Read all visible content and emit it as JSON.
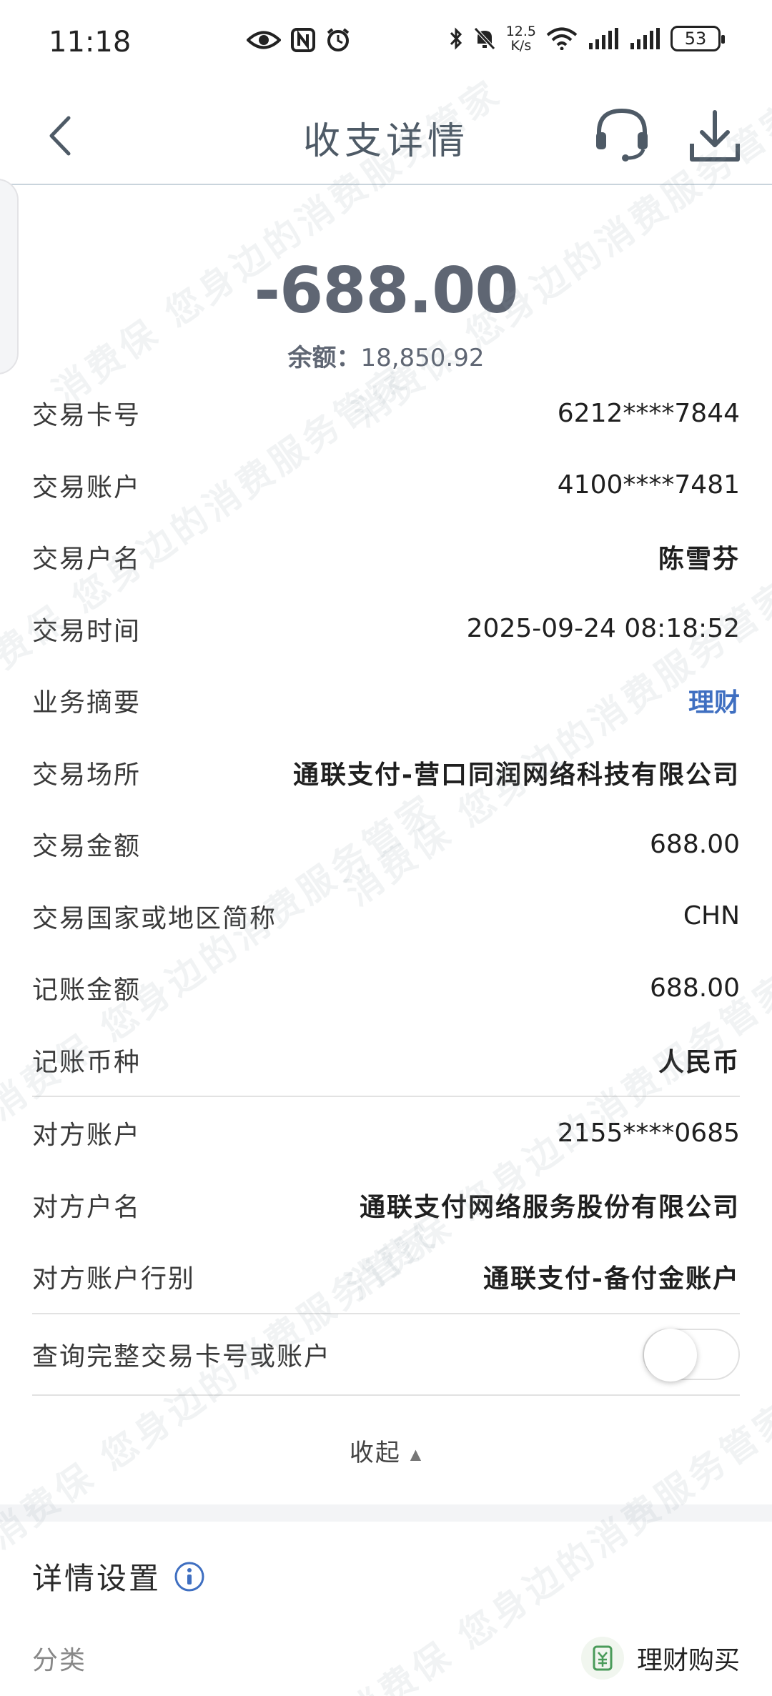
{
  "status_bar": {
    "time": "11:18",
    "net_speed_value": "12.5",
    "net_speed_unit": "K/s",
    "battery": "53",
    "icons": [
      "eye-icon",
      "nfc-icon",
      "alarm-icon",
      "bluetooth-icon",
      "mute-icon",
      "wifi-icon",
      "signal-icon",
      "signal-icon"
    ]
  },
  "header": {
    "title": "收支详情",
    "back_icon": "back-arrow-icon",
    "service_icon": "headset-icon",
    "download_icon": "download-icon"
  },
  "summary": {
    "amount": "-688.00",
    "balance_label": "余额：",
    "balance_value": "18,850.92"
  },
  "details": [
    {
      "label": "交易卡号",
      "value": "6212****7844"
    },
    {
      "label": "交易账户",
      "value": "4100****7481"
    },
    {
      "label": "交易户名",
      "value": "陈雪芬"
    },
    {
      "label": "交易时间",
      "value": "2025-09-24 08:18:52"
    },
    {
      "label": "业务摘要",
      "value": "理财"
    },
    {
      "label": "交易场所",
      "value": "通联支付-营口同润网络科技有限公司"
    },
    {
      "label": "交易金额",
      "value": "688.00"
    },
    {
      "label": "交易国家或地区简称",
      "value": "CHN"
    },
    {
      "label": "记账金额",
      "value": "688.00"
    },
    {
      "label": "记账币种",
      "value": "人民币"
    }
  ],
  "counterparty": [
    {
      "label": "对方账户",
      "value": "2155****0685"
    },
    {
      "label": "对方户名",
      "value": "通联支付网络服务股份有限公司"
    },
    {
      "label": "对方账户行别",
      "value": "通联支付-备付金账户"
    }
  ],
  "query_toggle": {
    "label": "查询完整交易卡号或账户",
    "state": "off"
  },
  "collapse_label": "收起",
  "settings": {
    "title": "详情设置",
    "category_label": "分类",
    "category_value": "理财购买"
  },
  "watermark_text": "消费保 您身边的消费服务管家",
  "colors": {
    "link": "#3f6fc1",
    "amount": "#5f6673",
    "header_title": "#4e5a66"
  }
}
